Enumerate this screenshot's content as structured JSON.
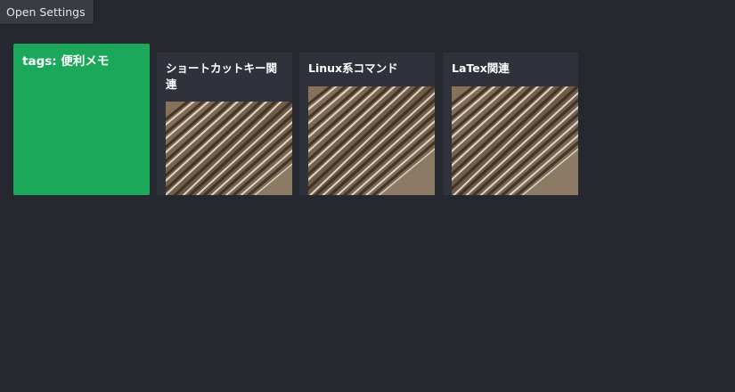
{
  "toolbar": {
    "open_settings_label": "Open Settings"
  },
  "tag_card": {
    "title": "tags: 便利メモ",
    "color": "#1ba85b"
  },
  "notes": [
    {
      "title": "ショートカットキー関連",
      "thumbnail_icon": "corrugated-texture-image"
    },
    {
      "title": "Linux系コマンド",
      "thumbnail_icon": "corrugated-texture-image"
    },
    {
      "title": "LaTex関連",
      "thumbnail_icon": "corrugated-texture-image"
    }
  ],
  "colors": {
    "background": "#262830",
    "card": "#2f323a",
    "accent": "#1ba85b"
  }
}
